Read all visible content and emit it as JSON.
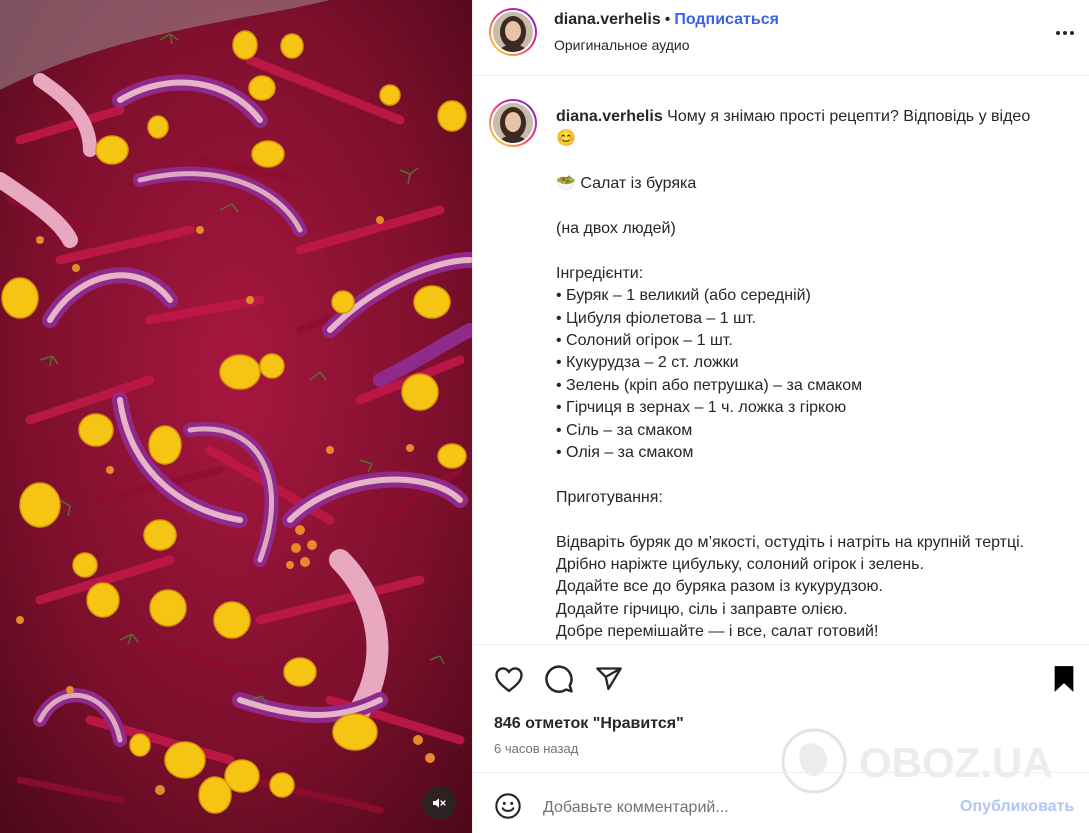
{
  "post": {
    "username": "diana.verhelis",
    "separator": "•",
    "follow_label": "Подписаться",
    "audio_label": "Оригинальное аудио"
  },
  "caption": {
    "username": "diana.verhelis",
    "lines": [
      "Чому я знімаю прості рецепти? Відповідь у відео",
      "😊",
      "",
      "🥗  Салат із буряка",
      "",
      "(на двох людей)",
      "",
      "Інгредієнти:",
      "• Буряк – 1 великий (або середній)",
      "• Цибуля фіолетова – 1 шт.",
      "• Солоний огірок – 1 шт.",
      "• Кукурудза – 2 ст. ложки",
      "• Зелень (кріп або петрушка) – за смаком",
      "• Гірчиця в зернах – 1 ч. ложка з гіркою",
      "• Сіль – за смаком",
      "• Олія – за смаком",
      "",
      "Приготування:",
      "",
      "Відваріть буряк до м’якості, остудіть і натріть на крупній тертці.",
      "Дрібно наріжте цибульку, солоний огірок і зелень.",
      "Додайте все до буряка разом із кукурудзою.",
      "Додайте гірчицю, сіль і заправте олією.",
      "Добре перемішайте — і все, салат готовий!"
    ]
  },
  "stats": {
    "likes": "846 отметок \"Нравится\"",
    "time": "6 часов назад"
  },
  "comment": {
    "placeholder": "Добавьте комментарий...",
    "publish_label": "Опубликовать"
  },
  "watermark": {
    "text": "OBOZ.UA"
  },
  "icons": {
    "like": "heart-icon",
    "comment": "comment-bubble-icon",
    "share": "paper-plane-icon",
    "save": "bookmark-icon",
    "more": "more-options-icon",
    "emoji": "emoji-icon",
    "mute": "muted-speaker-icon"
  },
  "colors": {
    "link_blue": "#3b62e8",
    "publish_disabled": "#b2c4f7",
    "text": "#262626",
    "secondary_text": "#737373"
  }
}
